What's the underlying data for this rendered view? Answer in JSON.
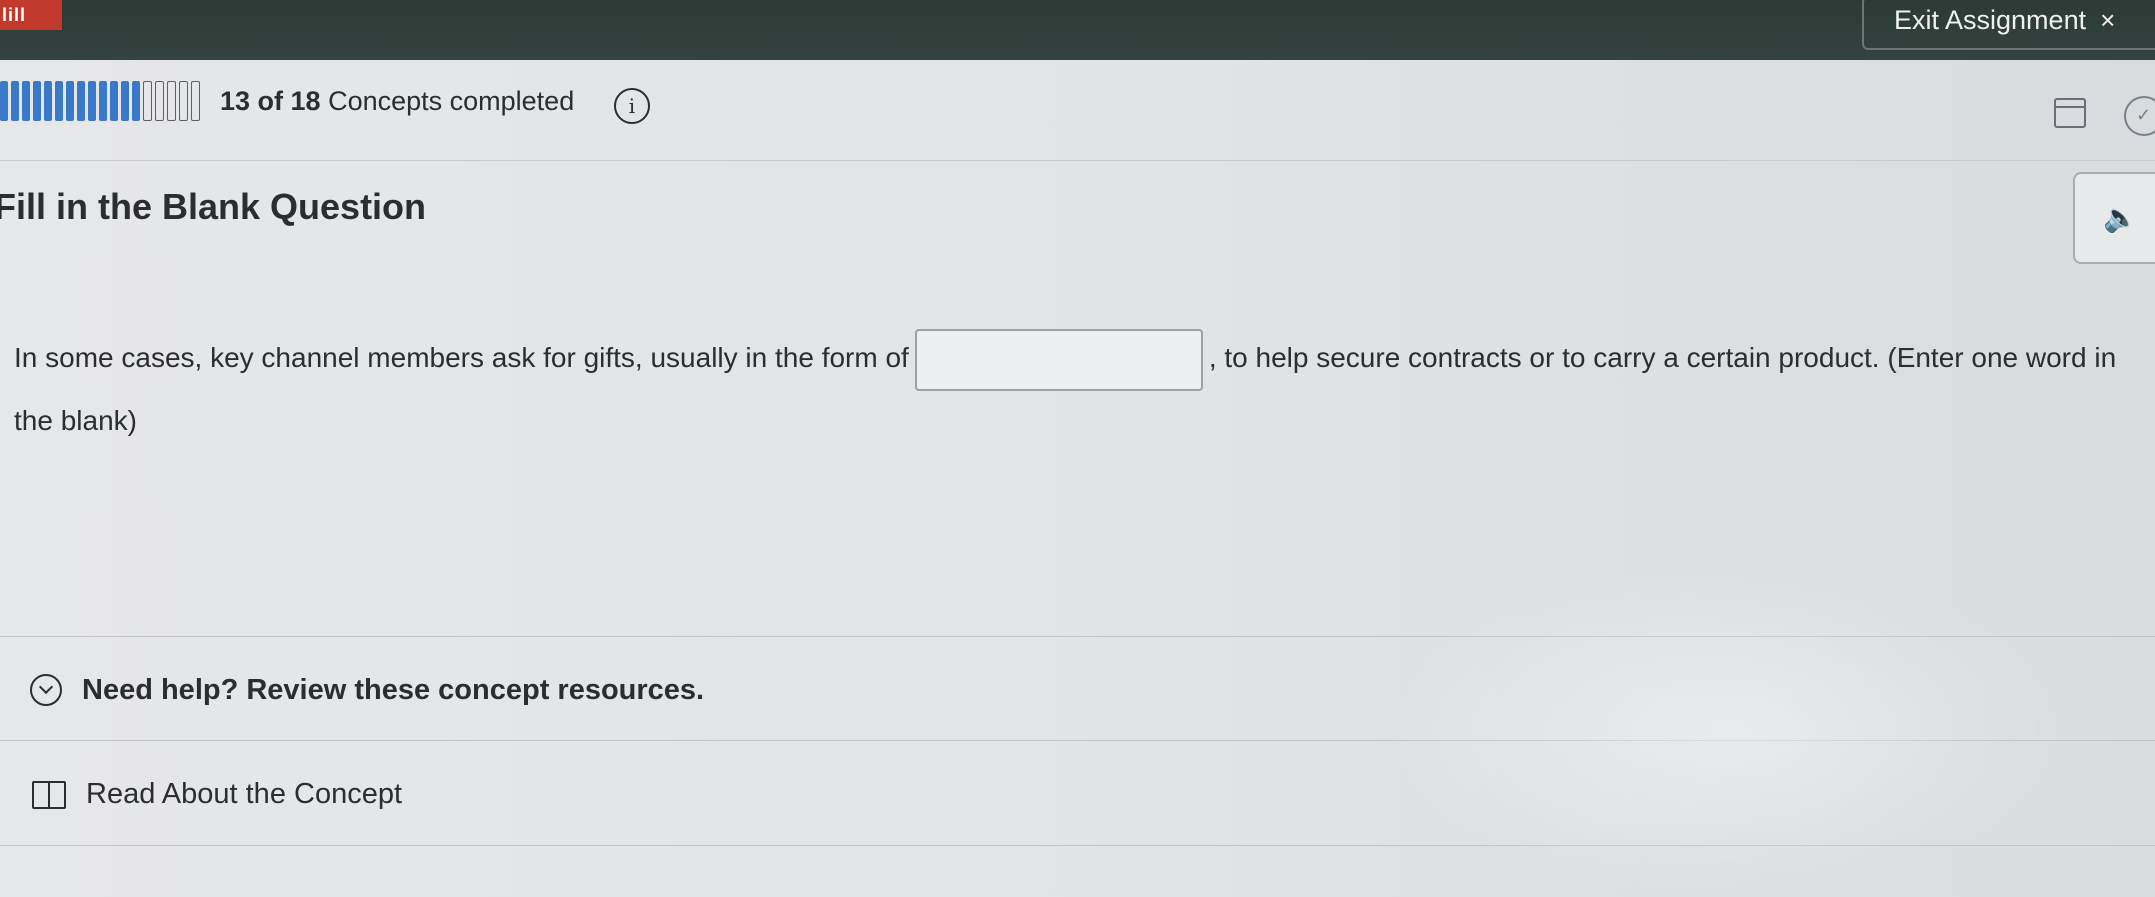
{
  "header": {
    "logo_text": "lill",
    "exit_label": "Exit Assignment",
    "exit_icon": "×"
  },
  "progress": {
    "completed": 13,
    "total": 18,
    "count_text": "13 of 18",
    "label": "Concepts completed",
    "info_icon": "i"
  },
  "question": {
    "title": "Fill in the Blank Question",
    "text_before": "In some cases, key channel members ask for gifts, usually in the form of",
    "blank_value": "",
    "text_after": ", to help secure contracts or to carry a certain product. (Enter one word in the blank)",
    "audio_icon": "🔈"
  },
  "help": {
    "toggle_label": "Need help? Review these concept resources.",
    "read_label": "Read About the Concept"
  },
  "colors": {
    "topbar": "#2c3a36",
    "progress_fill": "#3a78c9",
    "logo": "#c0392b"
  }
}
